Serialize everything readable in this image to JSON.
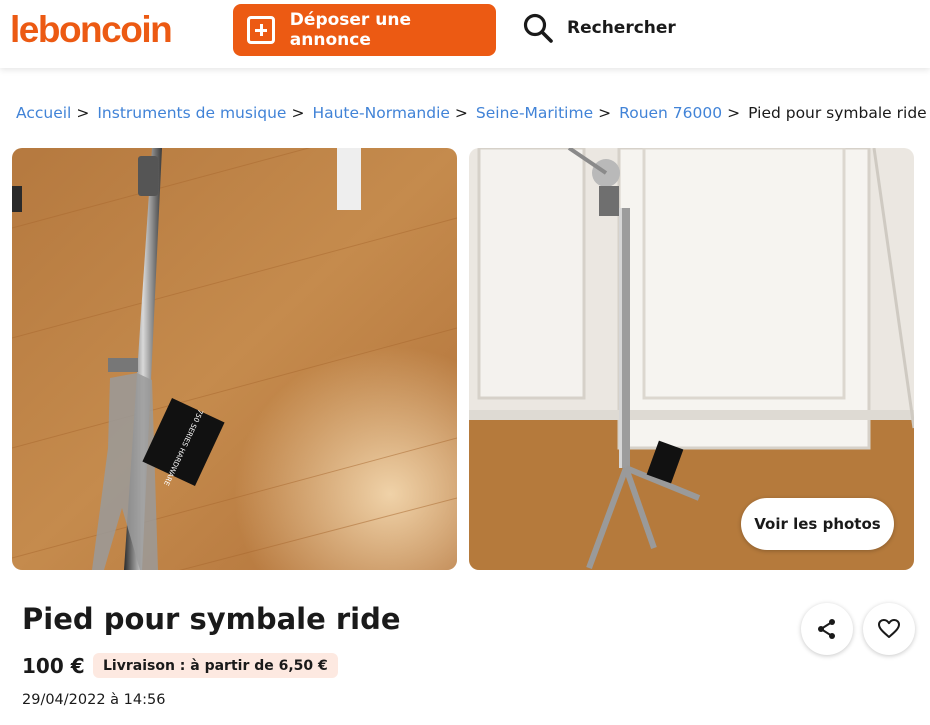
{
  "header": {
    "logo": "leboncoin",
    "post_label": "Déposer une annonce",
    "search_label": "Rechercher"
  },
  "breadcrumb": {
    "items": [
      "Accueil",
      "Instruments de musique",
      "Haute-Normandie",
      "Seine-Maritime",
      "Rouen 76000"
    ],
    "separator": ">",
    "current": "Pied pour symbale ride"
  },
  "gallery": {
    "see_photos_label": "Voir les photos",
    "tag_text": "750 SERIES HARDWARE"
  },
  "ad": {
    "title": "Pied pour symbale ride",
    "price": "100 €",
    "delivery": "Livraison : à partir de 6,50 €",
    "date": "29/04/2022 à 14:56"
  },
  "colors": {
    "brand": "#ec5a13",
    "link": "#4183d7",
    "delivery_bg": "#fde9e1"
  },
  "icons": {
    "post": "plus-square-icon",
    "search": "search-icon",
    "share": "share-icon",
    "favorite": "heart-icon"
  }
}
